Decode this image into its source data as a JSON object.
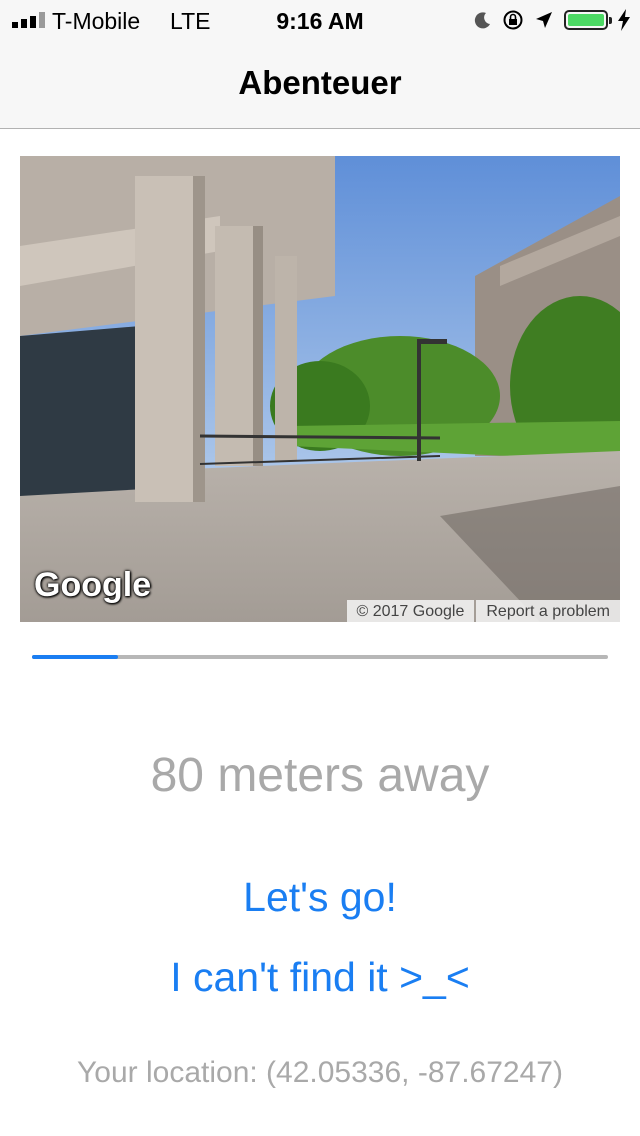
{
  "status_bar": {
    "carrier": "T-Mobile",
    "network": "LTE",
    "time": "9:16 AM",
    "battery_level": 0.95,
    "icons": [
      "signal-icon",
      "moon-icon",
      "orientation-lock-icon",
      "location-arrow-icon",
      "battery-icon",
      "charging-bolt-icon"
    ]
  },
  "nav": {
    "title": "Abenteuer"
  },
  "streetview": {
    "logo": "Google",
    "copyright": "© 2017 Google",
    "report": "Report a problem"
  },
  "progress": {
    "value": 0.15
  },
  "distance": "80 meters away",
  "actions": {
    "go": "Let's go!",
    "cant_find": "I can't find it >_<"
  },
  "location": "Your location: (42.05336, -87.67247)",
  "colors": {
    "accent": "#1a7ef2",
    "muted_text": "#a9a9a9",
    "battery": "#4cd964"
  }
}
